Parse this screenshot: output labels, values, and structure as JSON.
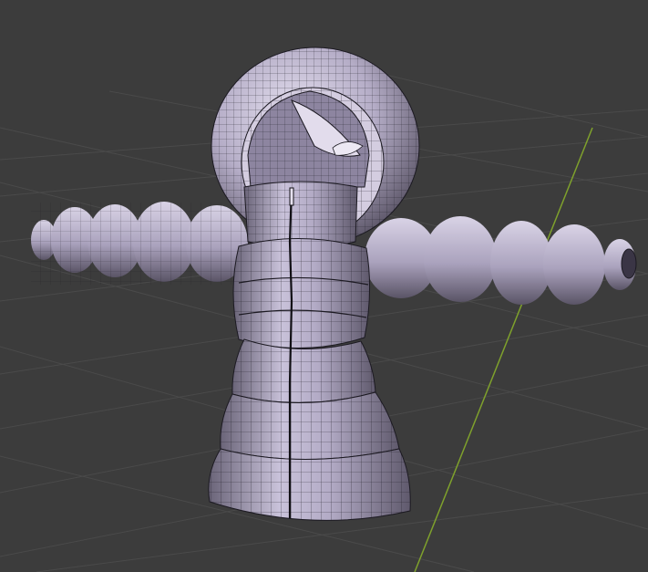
{
  "viewport": {
    "kind": "3d-viewport",
    "shading": "solid-wireframe",
    "object": "puffer-jacket-character",
    "colors": {
      "background": "#3c3c3c",
      "grid": "#4a4a4a",
      "y_axis": "#7fa12c",
      "mesh_face": "#b5adc7",
      "mesh_shadow": "#5a5466",
      "wire": "#1c1a22",
      "highlight": "#e6e1f0"
    }
  }
}
